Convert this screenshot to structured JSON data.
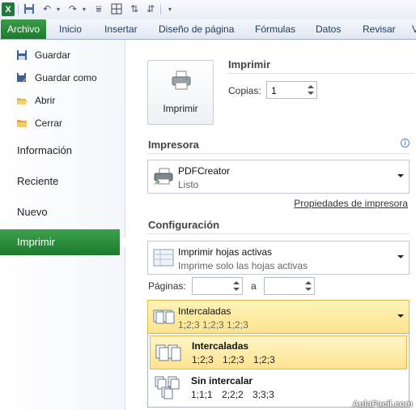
{
  "ribbon": {
    "tabs": [
      "Archivo",
      "Inicio",
      "Insertar",
      "Diseño de página",
      "Fórmulas",
      "Datos",
      "Revisar",
      "V"
    ]
  },
  "nav": {
    "commands": [
      "Guardar",
      "Guardar como",
      "Abrir",
      "Cerrar"
    ],
    "sections": [
      "Información",
      "Reciente",
      "Nuevo",
      "Imprimir"
    ]
  },
  "print": {
    "heading": "Imprimir",
    "button_label": "Imprimir",
    "copies_label": "Copias:",
    "copies_value": "1"
  },
  "printer": {
    "heading": "Impresora",
    "name": "PDFCreator",
    "status": "Listo",
    "properties_link": "Propiedades de impresora"
  },
  "settings": {
    "heading": "Configuración",
    "scope_title": "Imprimir hojas activas",
    "scope_desc": "Imprime solo las hojas activas",
    "pages_label": "Páginas:",
    "to_label": "a",
    "pages_from": "",
    "pages_to": "",
    "collate_title": "Intercaladas",
    "collate_desc": "1;2;3   1;2;3   1;2;3"
  },
  "collate_menu": {
    "items": [
      {
        "title": "Intercaladas",
        "desc": "1;2;3 1;2;3 1;2;3"
      },
      {
        "title": "Sin intercalar",
        "desc": "1;1;1 2;2;2 3;3;3"
      }
    ]
  },
  "colors": {
    "accent_green": "#1e7a2f",
    "highlight": "#fde38e"
  },
  "watermark": "AulaFacil.com"
}
